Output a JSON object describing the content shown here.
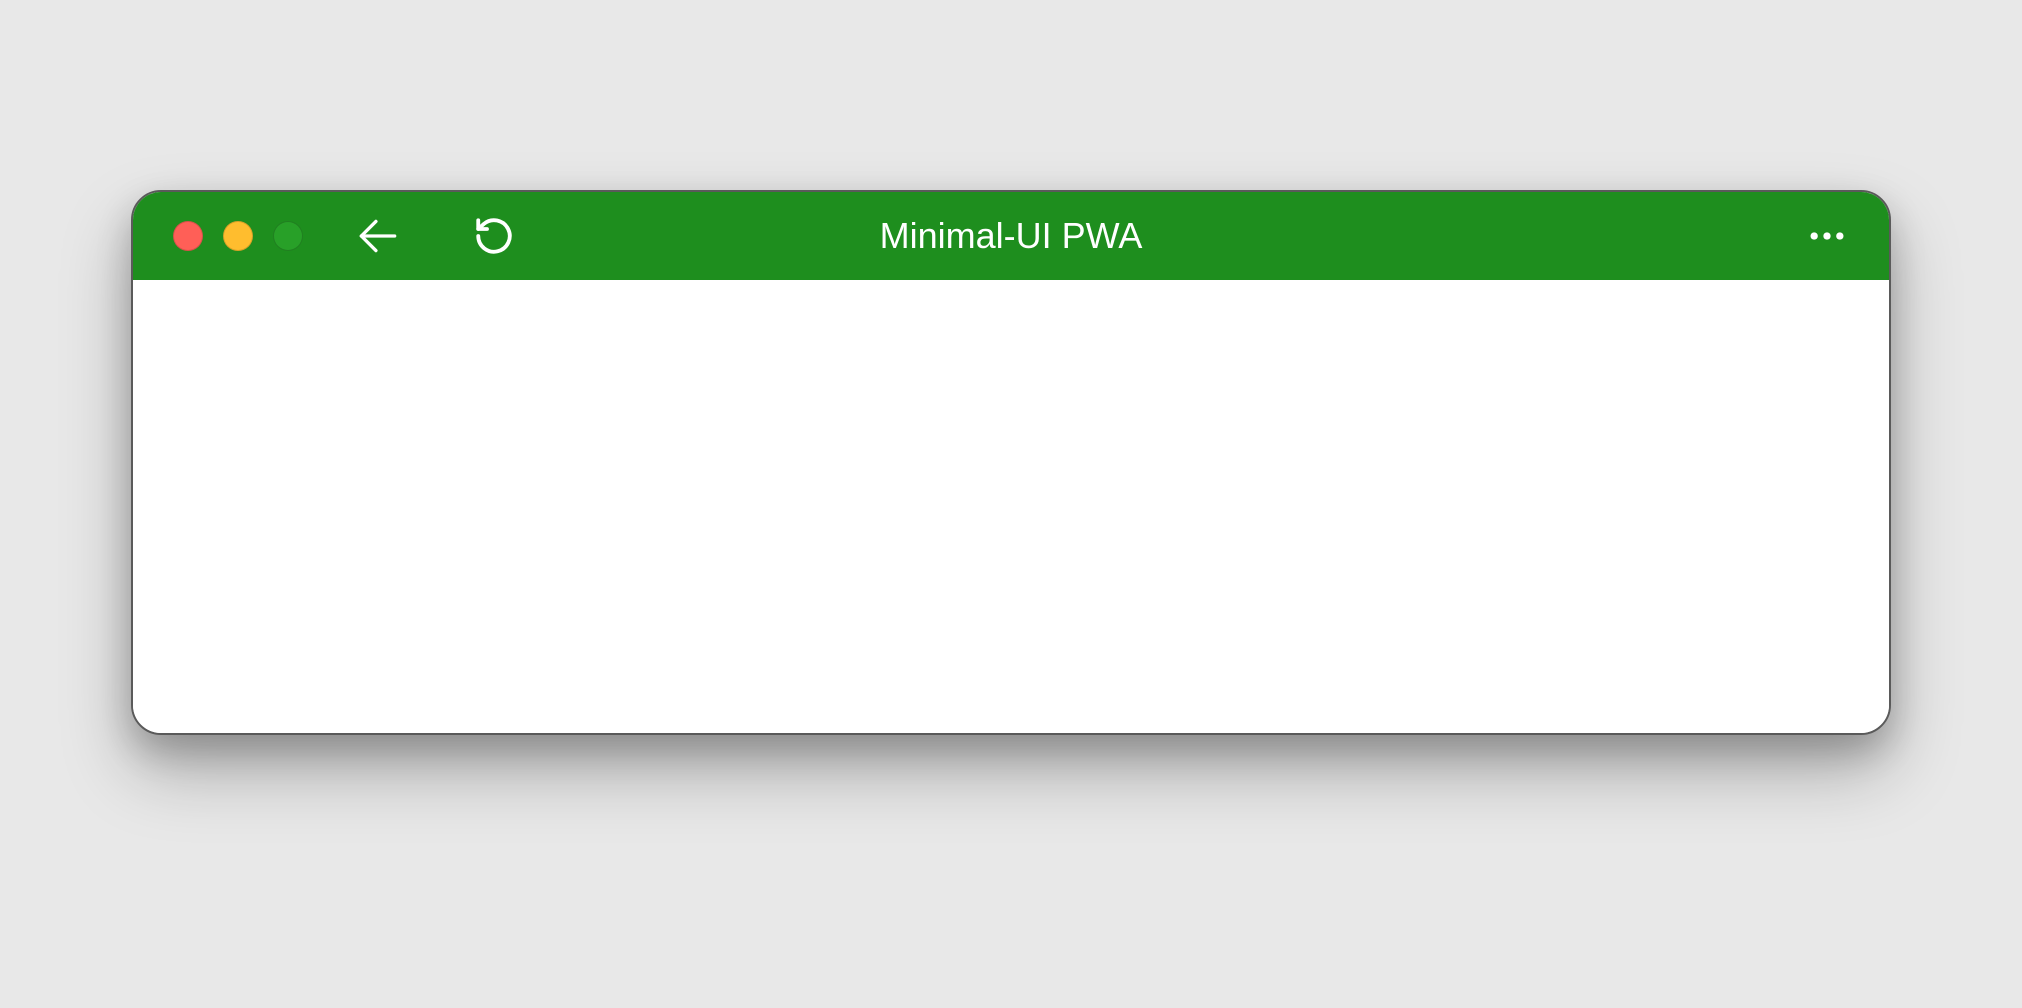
{
  "window": {
    "title": "Minimal-UI PWA"
  },
  "colors": {
    "titlebar": "#1e8e1e",
    "content": "#ffffff",
    "background": "#e8e8e8"
  },
  "icons": {
    "back": "back-arrow-icon",
    "reload": "reload-icon",
    "menu": "more-horizontal-icon"
  }
}
